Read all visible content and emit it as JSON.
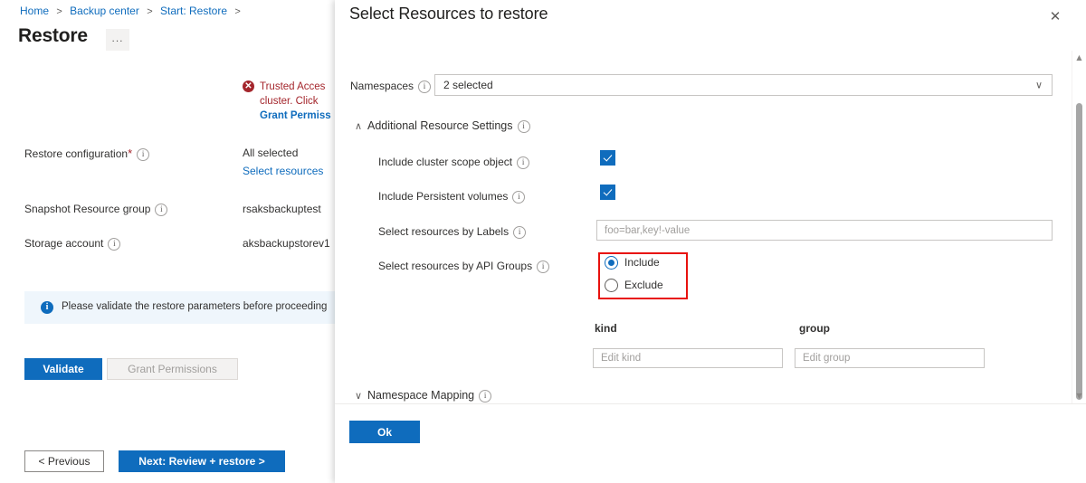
{
  "blade": {
    "breadcrumb": {
      "items": [
        "Home",
        "Backup center",
        "Start: Restore"
      ],
      "separator": ">",
      "trailing_separator": ">"
    },
    "title": "Restore",
    "more_button_label": "...",
    "error": {
      "icon": "error-circle-icon",
      "glyph": "✕",
      "text": "Trusted Acces cluster. Click ",
      "link_text": "Grant Permiss"
    },
    "fields": [
      {
        "label": "Restore configuration",
        "required_mark": "*",
        "info_glyph": "i",
        "value": "All selected",
        "link_text": "Select resources"
      },
      {
        "label": "Snapshot Resource group",
        "info_glyph": "i",
        "value": "rsaksbackuptest"
      },
      {
        "label": "Storage account",
        "info_glyph": "i",
        "value": "aksbackupstorev1"
      }
    ],
    "info_banner": {
      "icon": "info-circle-icon",
      "glyph": "i",
      "text": "Please validate the restore parameters before proceeding",
      "background": "#eff6fc",
      "accent": "#0f6cbd"
    },
    "actions": {
      "validate_label": "Validate",
      "grant_permissions_label": "Grant Permissions"
    },
    "wizard_nav": {
      "previous_label": "< Previous",
      "next_label": "Next: Review + restore >"
    }
  },
  "panel": {
    "title": "Select Resources to restore",
    "close_glyph": "✕",
    "namespaces": {
      "label": "Namespaces",
      "info_glyph": "i",
      "value": "2 selected",
      "chevron_glyph": "∨"
    },
    "sections": [
      {
        "name": "additional-resource-settings",
        "label": "Additional Resource Settings",
        "info_glyph": "i",
        "caret_glyph": "∧",
        "expanded": true
      },
      {
        "name": "namespace-mapping",
        "label": "Namespace Mapping",
        "info_glyph": "i",
        "caret_glyph": "∨",
        "expanded": false
      }
    ],
    "settings": {
      "include_cluster_scope": {
        "label": "Include cluster scope object",
        "info_glyph": "i",
        "checked": true
      },
      "include_persistent_volumes": {
        "label": "Include Persistent volumes",
        "info_glyph": "i",
        "checked": true
      },
      "labels_filter": {
        "label": "Select resources by Labels",
        "info_glyph": "i",
        "value": "",
        "placeholder": "foo=bar,key!-value"
      },
      "api_groups": {
        "label": "Select resources by API Groups",
        "info_glyph": "i",
        "selected": "Include",
        "options": [
          "Include",
          "Exclude"
        ],
        "highlight_color": "#e8120e"
      },
      "api_groups_table": {
        "columns": [
          "kind",
          "group"
        ],
        "rows": [
          {
            "kind": "",
            "kind_placeholder": "Edit kind",
            "group": "",
            "group_placeholder": "Edit group"
          }
        ]
      }
    },
    "footer": {
      "ok_label": "Ok"
    },
    "scrollbar": {
      "up_glyph": "▲",
      "down_glyph": "▼"
    }
  },
  "theme": {
    "accent": "#0f6cbd",
    "error": "#a4262c",
    "annotation": "#e8120e",
    "text": "#323130",
    "muted": "#605e5c"
  }
}
